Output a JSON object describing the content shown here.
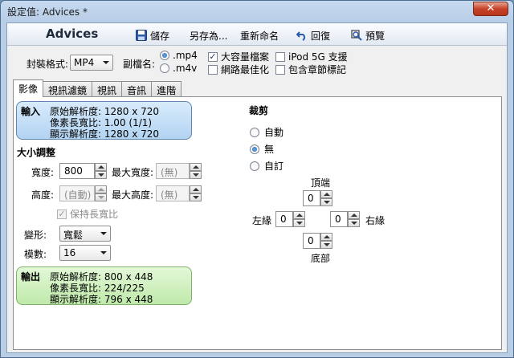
{
  "window": {
    "title": "設定值: Advices *",
    "close_glyph": "✕"
  },
  "toolbar": {
    "preset_name": "Advices",
    "save_label": "儲存",
    "save_as_label": "另存為...",
    "rename_label": "重新命名",
    "revert_label": "回復",
    "preview_label": "預覽"
  },
  "options": {
    "container_label": "封裝格式:",
    "container_value": "MP4",
    "extension_label": "副檔名:",
    "ext_mp4": ".mp4",
    "ext_m4v": ".m4v",
    "large_file_label": "大容量檔案",
    "web_optimized_label": "網路最佳化",
    "ipod_label": "iPod 5G 支援",
    "chapters_label": "包含章節標記"
  },
  "tabs": [
    "影像",
    "視訊濾鏡",
    "視訊",
    "音訊",
    "進階"
  ],
  "input_box": {
    "heading": "輸入",
    "line1": "原始解析度: 1280 x 720",
    "line2": "像素長寬比: 1.00 (1/1)",
    "line3": "顯示解析度: 1280 x 720"
  },
  "size": {
    "section_title": "大小調整",
    "width_label": "寬度:",
    "width_value": "800",
    "max_width_label": "最大寬度:",
    "max_width_value": "(無)",
    "height_label": "高度:",
    "height_value": "(自動)",
    "max_height_label": "最大高度:",
    "max_height_value": "(無)",
    "keep_aspect_label": "保持長寬比",
    "anamorphic_label": "變形:",
    "anamorphic_value": "寬鬆",
    "modulus_label": "模數:",
    "modulus_value": "16"
  },
  "output_box": {
    "heading": "輸出",
    "line1": "原始解析度: 800 x 448",
    "line2": "像素長寬比: 224/225",
    "line3": "顯示解析度: 796 x 448"
  },
  "crop": {
    "section_title": "裁剪",
    "auto_label": "自動",
    "none_label": "無",
    "custom_label": "自訂",
    "top_label": "頂端",
    "top_value": "0",
    "left_label": "左緣",
    "left_value": "0",
    "right_label": "右緣",
    "right_value": "0",
    "bottom_label": "底部",
    "bottom_value": "0"
  },
  "colors": {
    "accent": "#1f5fa8",
    "input_box_bg": "#b2d3f2",
    "output_box_bg": "#bfe9aa",
    "close_button": "#c7432a"
  }
}
